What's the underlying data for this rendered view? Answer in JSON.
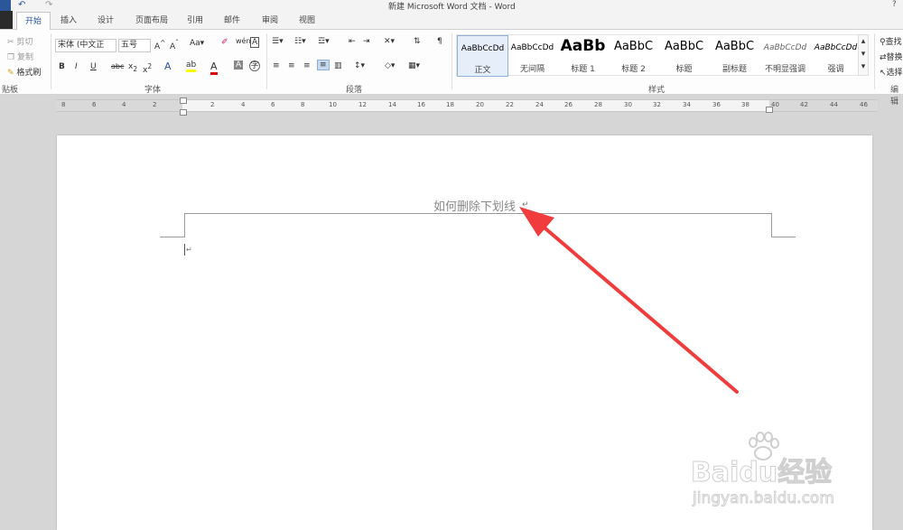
{
  "window": {
    "title": "新建 Microsoft Word 文档 - Word"
  },
  "tabs": [
    "开始",
    "插入",
    "设计",
    "页面布局",
    "引用",
    "邮件",
    "审阅",
    "视图"
  ],
  "clipboard": {
    "cut": "剪切",
    "copy": "复制",
    "format_painter": "格式刷",
    "group": "贴板"
  },
  "font": {
    "name": "宋体 (中文正",
    "size": "五号",
    "group": "字体"
  },
  "paragraph": {
    "group": "段落"
  },
  "styles": {
    "group": "样式",
    "items": [
      {
        "sample": "AaBbCcDd",
        "name": "正文"
      },
      {
        "sample": "AaBbCcDd",
        "name": "无间隔"
      },
      {
        "sample": "AaBb",
        "name": "标题 1"
      },
      {
        "sample": "AaBbC",
        "name": "标题 2"
      },
      {
        "sample": "AaBbC",
        "name": "标题"
      },
      {
        "sample": "AaBbC",
        "name": "副标题"
      },
      {
        "sample": "AaBbCcDd",
        "name": "不明显强调"
      },
      {
        "sample": "AaBbCcDd",
        "name": "强调"
      }
    ]
  },
  "editing": {
    "find": "查找",
    "replace": "替换",
    "select": "选择",
    "group": "编辑"
  },
  "ruler": [
    "8",
    "6",
    "4",
    "2",
    "2",
    "4",
    "6",
    "8",
    "10",
    "12",
    "14",
    "16",
    "18",
    "20",
    "22",
    "24",
    "26",
    "28",
    "30",
    "32",
    "34",
    "36",
    "38",
    "40",
    "42",
    "44",
    "46",
    "48"
  ],
  "document": {
    "header_text": "如何删除下划线"
  },
  "watermark": {
    "text1": "Baidu经验",
    "text2": "jingyan.baidu.com"
  }
}
